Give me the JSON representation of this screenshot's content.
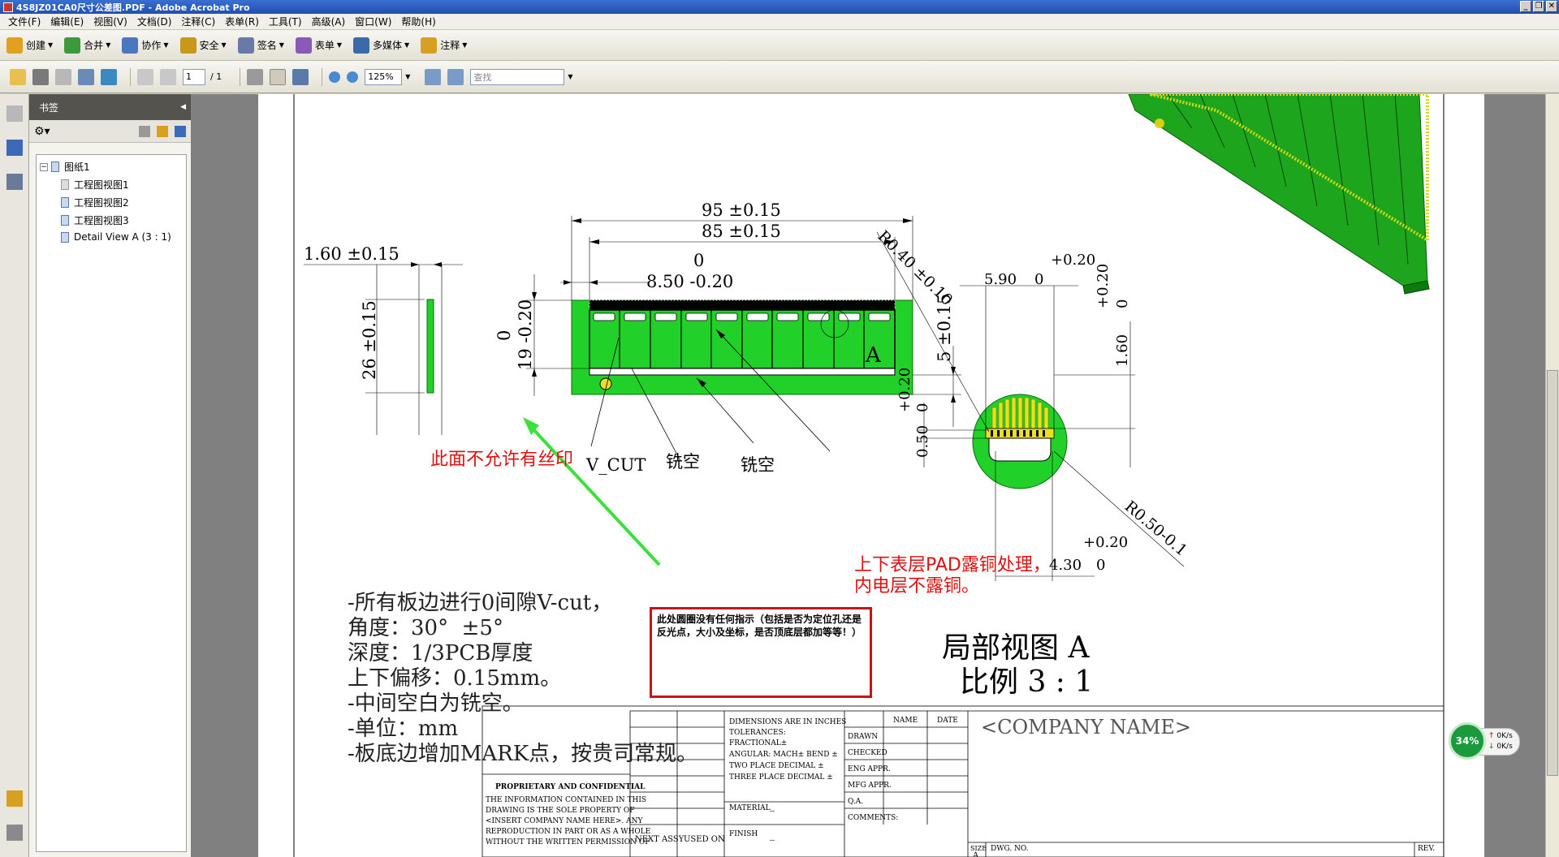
{
  "window": {
    "title": "4S8JZ01CA0尺寸公差图.PDF - Adobe Acrobat Pro",
    "btns": [
      "_",
      "❐",
      "✕"
    ]
  },
  "menu": [
    "文件(F)",
    "编辑(E)",
    "视图(V)",
    "文档(D)",
    "注释(C)",
    "表单(R)",
    "工具(T)",
    "高级(A)",
    "窗口(W)",
    "帮助(H)"
  ],
  "toolbar1": [
    {
      "label": "创建",
      "color": "#e0a020"
    },
    {
      "label": "合并",
      "color": "#3c9a3c"
    },
    {
      "label": "协作",
      "color": "#4a78c0"
    },
    {
      "label": "安全",
      "color": "#c89818"
    },
    {
      "label": "签名",
      "color": "#6a7aa8"
    },
    {
      "label": "表单",
      "color": "#8a5ab8"
    },
    {
      "label": "多媒体",
      "color": "#3a6aa8"
    },
    {
      "label": "注释",
      "color": "#d8a020"
    }
  ],
  "toolbar2": {
    "page_current": "1",
    "page_total": "/ 1",
    "zoom": "125%",
    "search_placeholder": "查找"
  },
  "panel": {
    "title": "书签",
    "tree": [
      {
        "label": "图纸1",
        "level": 0
      },
      {
        "label": "工程图视图1",
        "level": 1
      },
      {
        "label": "工程图视图2",
        "level": 1
      },
      {
        "label": "工程图视图3",
        "level": 1
      },
      {
        "label": "Detail View A (3 : 1)",
        "level": 1
      }
    ]
  },
  "drawing": {
    "dim_95": "95 ±0.15",
    "dim_85": "85 ±0.15",
    "dim_0a": "0",
    "dim_850": "8.50 -0.20",
    "dim_160": "1.60 ±0.15",
    "dim_26": "26 ±0.15",
    "dim_0b": "0",
    "dim_19": "19 -0.20",
    "dim_5": "5 ±0.15",
    "letter_a": "A",
    "r040": "R0.40 ±0.10",
    "r050": "R0.50-0.1",
    "d590": "5.90",
    "d590_tol": "+0.20",
    "d590_zero": "0",
    "d160v": "1.60",
    "d160v_tol": "+0.20",
    "d160v_zero": "0",
    "d050": "0.50",
    "d050_tol": "+0.20",
    "d050_zero": "0",
    "d430": "4.30",
    "d430_tol": "+0.20",
    "d430_zero": "0",
    "vcut": "V_CUT",
    "mill1": "铣空",
    "mill2": "铣空",
    "detail_title": "局部视图 A",
    "detail_scale": "比例 3 : 1",
    "no_silk": "此面不允许有丝印",
    "pad_note1": "上下表层PAD露铜处理，",
    "pad_note2": "内电层不露铜。",
    "notes": [
      "-所有板边进行0间隙V-cut，",
      "角度：30°  ±5°",
      "深度：1/3PCB厚度",
      "上下偏移：0.15mm。",
      "-中间空白为铣空。",
      "-单位：mm",
      "-板底边增加MARK点，按贵司常规。"
    ],
    "callout": "此处圆圈没有任何指示（包括是否为定位孔还是反光点，大小及坐标，是否顶底层都加等等！）"
  },
  "titleblock": {
    "tol_lines": [
      "DIMENSIONS ARE IN INCHES",
      "TOLERANCES:",
      "FRACTIONAL±",
      "ANGULAR: MACH±     BEND ±",
      "TWO PLACE DECIMAL    ±",
      "THREE PLACE DECIMAL  ±"
    ],
    "name": "NAME",
    "date": "DATE",
    "rows": [
      "DRAWN",
      "CHECKED",
      "ENG APPR.",
      "MFG APPR.",
      "Q.A.",
      "COMMENTS:"
    ],
    "company": "<COMPANY NAME>",
    "prop_title": "PROPRIETARY AND CONFIDENTIAL",
    "prop_lines": [
      "THE INFORMATION CONTAINED IN THIS",
      "DRAWING IS THE SOLE PROPERTY OF",
      "<INSERT COMPANY NAME HERE>.  ANY",
      "REPRODUCTION IN PART OR AS A WHOLE",
      "WITHOUT THE WRITTEN PERMISSION OF"
    ],
    "material": "MATERIAL",
    "finish": "FINISH",
    "dash": "--",
    "next_assy": "NEXT ASSY",
    "used_on": "USED ON",
    "size": "SIZE",
    "size_val": "A",
    "dwg": "DWG.  NO.",
    "rev": "REV."
  },
  "perf": {
    "cpu": "34%",
    "up": "0K/s",
    "down": "0K/s"
  },
  "colors": {
    "pcb": "#22d02a",
    "pcb_edge": "#0c6a0c",
    "pad": "#e8e020",
    "red": "#e01010",
    "arrow": "#3ce03c"
  }
}
